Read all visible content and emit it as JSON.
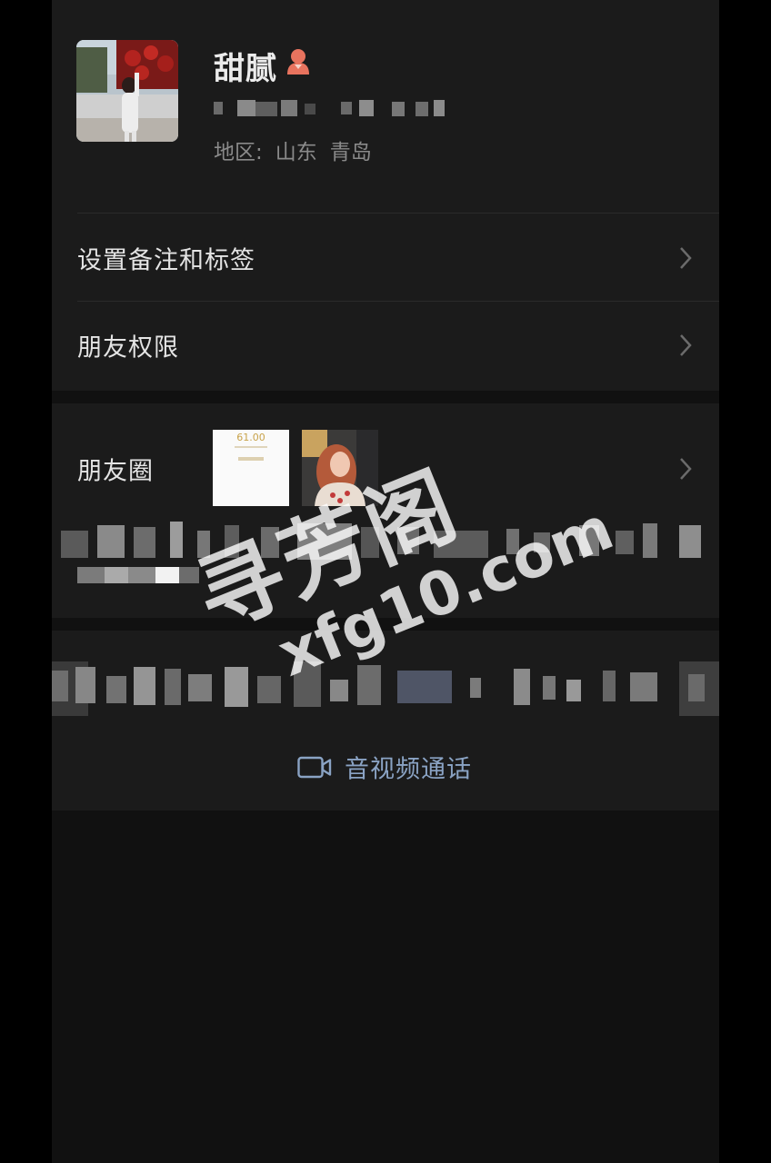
{
  "profile": {
    "name": "甜腻",
    "gender_icon": "female-contact-icon",
    "wechat_id_hidden": true,
    "region_label": "地区:",
    "region_province": "山东",
    "region_city": "青岛"
  },
  "menu": {
    "remark_tags_label": "设置备注和标签",
    "friend_permissions_label": "朋友权限",
    "moments_label": "朋友圈",
    "moments_first_thumb_text": "61.00"
  },
  "actions": {
    "video_call_label": "音视频通话",
    "video_call_icon": "video-camera-icon"
  },
  "watermark": {
    "main": "寻芳阁",
    "site": "xfg10.com"
  },
  "colors": {
    "screen_background": "#111111",
    "card_background": "#1b1b1b",
    "primary_text": "#e4e4e4",
    "secondary_text": "#8a8a8a",
    "link_text": "#8aa3c4",
    "gender_icon": "#e8735e"
  }
}
